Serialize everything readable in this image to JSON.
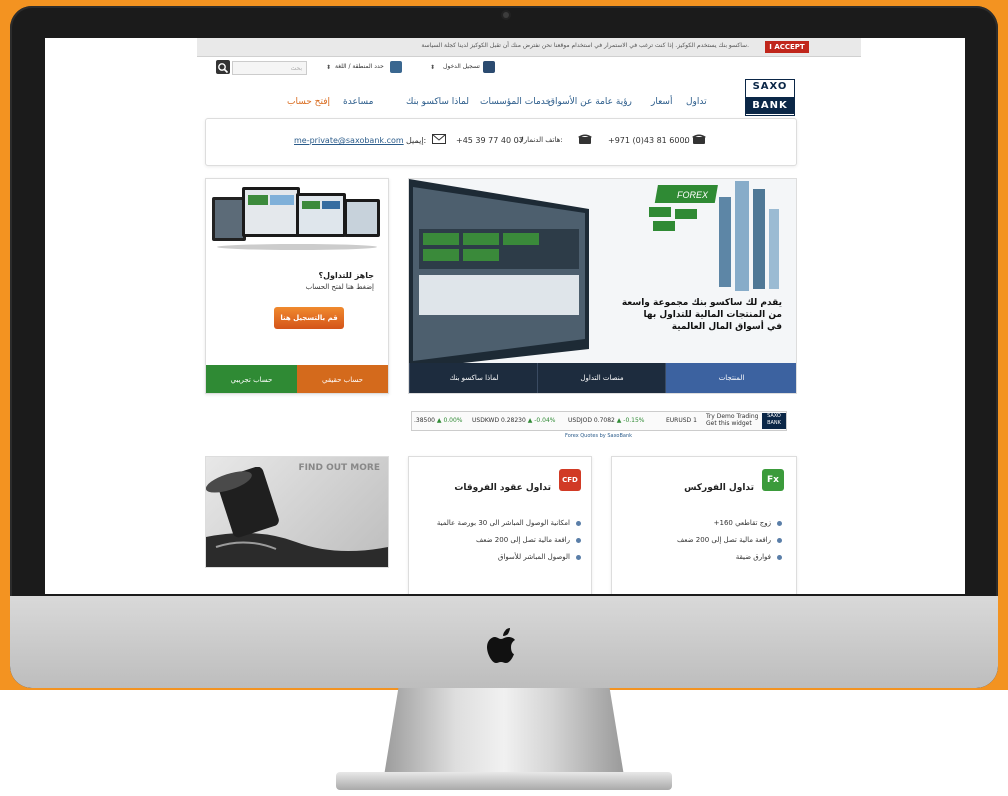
{
  "cookie_bar": {
    "text": "ساكسو بنك يستخدم الكوكيز. إذا كنت ترغب في الاستمرار في استخدام موقعنا نحن نفترض منك أن تقبل الكوكيز لدينا كجلة السياسة.",
    "accept_label": "I ACCEPT"
  },
  "utility": {
    "login_label": "تسجيل الدخول",
    "region_label": "حدد المنطقة / اللغة",
    "search_placeholder": "بحث"
  },
  "logo": {
    "line1": "SAXO",
    "line2": "BANK"
  },
  "nav": {
    "items": [
      "تداول",
      "أسعار",
      "رؤية عامة عن الأسواق",
      "خدمات المؤسسات",
      "لماذا ساكسو بنك",
      "مساعدة"
    ],
    "open_account": "إفتح حساب"
  },
  "contact": {
    "phone_prefix": ":",
    "phone1": "+971 (0)43 81 6000",
    "phone2_label": "هاتف الدنمارك:",
    "phone2": "+45 39 77 40 07",
    "email_label": "إيميل:",
    "email": "me-private@saxobank.com"
  },
  "promo": {
    "title": "جاهز للتداول؟",
    "subtitle": "إضغط هنا لفتح الحساب",
    "button": "قم بالتسجيل هنا",
    "tab_real": "حساب حقيقي",
    "tab_demo": "حساب تجريبي"
  },
  "hero": {
    "line1": "يقدم لك ساكسو بنك مجموعة واسعة",
    "line2": "من المنتجات المالية للتداول بها",
    "line3": "في أسواق المال العالمية",
    "forex_label": "FOREX",
    "tabs": [
      "المنتجات",
      "منصات التداول",
      "لماذا ساكسو بنك"
    ]
  },
  "ticker": {
    "items": [
      {
        "sym": ".38500",
        "chg": "▲ 0.00%"
      },
      {
        "sym": "USDKWD 0.28230",
        "chg": "▲ -0.04%"
      },
      {
        "sym": "USDJOD 0.7082",
        "chg": "▲ -0.15%"
      },
      {
        "sym": "EURUSD 1",
        "chg": ""
      }
    ],
    "try_text": "Try Demo Trading",
    "get_widget": "Get this widget",
    "caption": "Forex Quotes by SaxoBank",
    "logo1": "SAXO",
    "logo2": "BANK"
  },
  "boxes": {
    "forex": {
      "badge": "Fx",
      "title": "تداول الفوركس",
      "items": [
        "+160 زوج تقاطعي",
        "رافعة مالية تصل إلى 200 ضعف",
        "فوارق ضيقة"
      ]
    },
    "cfd": {
      "badge": "CFD",
      "title": "تداول عقود الفروقات",
      "items": [
        "امكانية الوصول المباشر الى 30 بورصة عالمية",
        "رافعة مالية تصل إلى 200 ضعف",
        "الوصول المباشر للأسواق"
      ]
    },
    "promo": {
      "find_more": "FIND OUT MORE"
    }
  },
  "colors": {
    "background": "#f39321",
    "brand_navy": "#0b2747",
    "accent_orange": "#d46a1c",
    "accent_green": "#2f8a34",
    "link_blue": "#2a5b8a",
    "accept_red": "#c0261b"
  }
}
